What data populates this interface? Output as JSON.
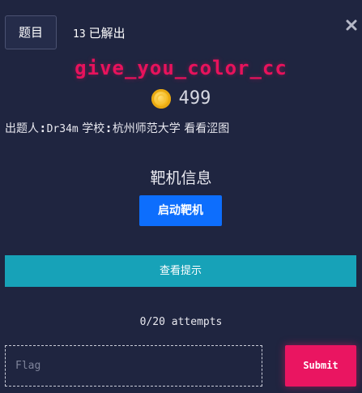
{
  "header": {
    "tab_label": "题目",
    "solve_count": "13",
    "solve_label": "已解出",
    "close_icon": "close-icon"
  },
  "challenge": {
    "title": "give_you_color_cc",
    "points": "499",
    "points_icon": "coin-icon",
    "author_label": "出题人",
    "author": "Dr34m",
    "school_label": "学校",
    "school": "杭州师范大学",
    "extra": "看看涩图"
  },
  "target": {
    "section_title": "靶机信息",
    "start_button": "启动靶机"
  },
  "hint": {
    "button_label": "查看提示"
  },
  "submission": {
    "attempts": "0/20 attempts",
    "flag_placeholder": "Flag",
    "flag_value": "",
    "submit_label": "Submit"
  },
  "colors": {
    "background": "#1f2540",
    "title": "#e8125c",
    "start_button": "#0d6efd",
    "hint_button": "#17a2b8",
    "submit_button": "#ea1561"
  }
}
